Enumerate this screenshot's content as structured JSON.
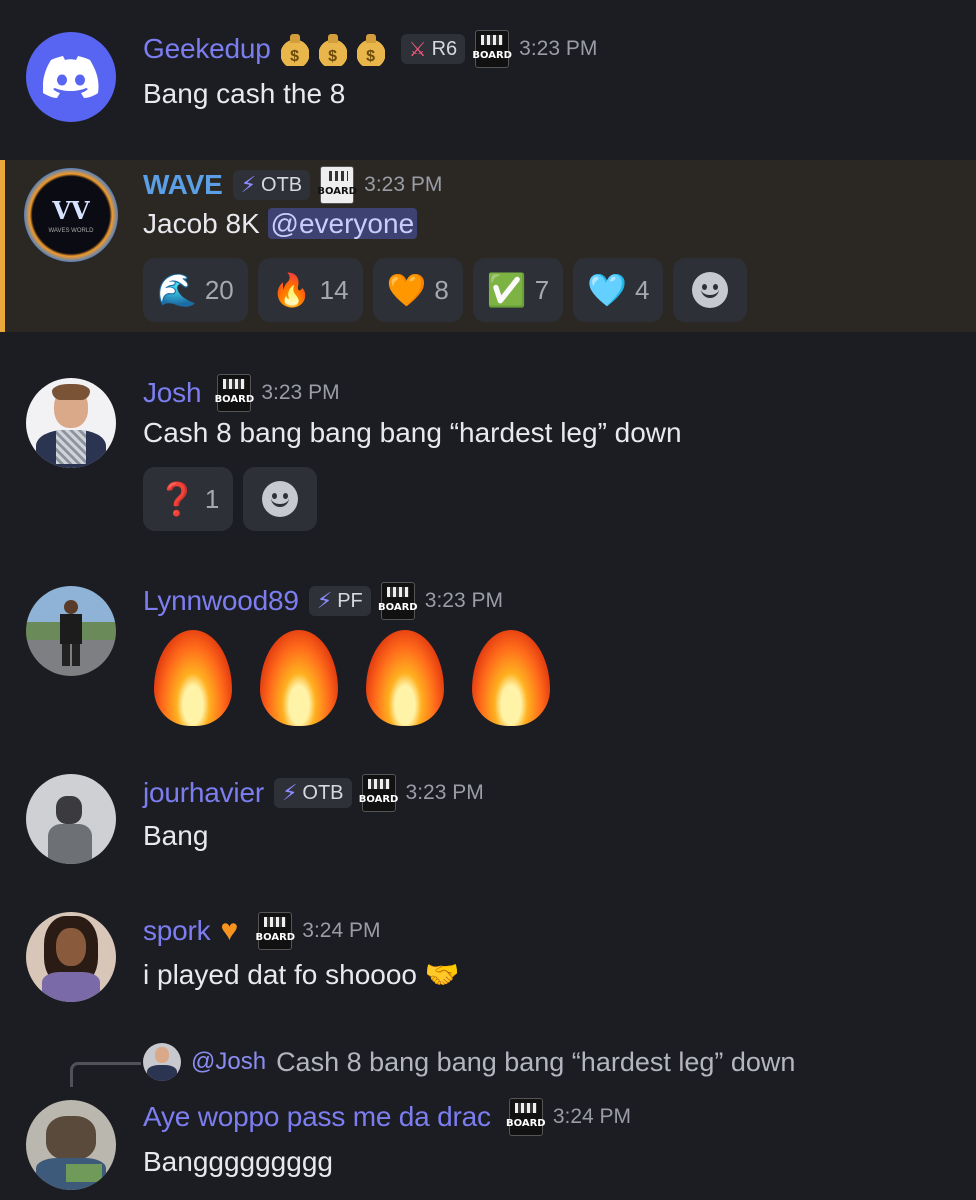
{
  "messages": [
    {
      "username": "Geekedup",
      "time": "3:23 PM",
      "tag_label": "R6",
      "board": "BOARD",
      "text": "Bang cash the 8",
      "bag_symbol": "$"
    },
    {
      "username": "WAVE",
      "time": "3:23 PM",
      "tag_label": "OTB",
      "board": "BOARD",
      "text_prefix": "Jacob 8K ",
      "mention": "@everyone",
      "reactions": [
        {
          "emoji_name": "wave",
          "emoji": "🌊",
          "count": "20"
        },
        {
          "emoji_name": "fire",
          "emoji": "🔥",
          "count": "14"
        },
        {
          "emoji_name": "orange-heart",
          "emoji": "🧡",
          "count": "8"
        },
        {
          "emoji_name": "check-mark",
          "emoji": "✅",
          "count": "7"
        },
        {
          "emoji_name": "blue-heart",
          "emoji": "🩵",
          "count": "4"
        }
      ]
    },
    {
      "username": "Josh",
      "time": "3:23 PM",
      "board": "BOARD",
      "text": "Cash 8 bang bang bang “hardest leg” down",
      "reactions": [
        {
          "emoji_name": "question-mark",
          "emoji": "❓",
          "count": "1"
        }
      ]
    },
    {
      "username": "Lynnwood89",
      "time": "3:23 PM",
      "tag_label": "PF",
      "board": "BOARD",
      "fire_count": 4
    },
    {
      "username": "jourhavier",
      "time": "3:23 PM",
      "tag_label": "OTB",
      "board": "BOARD",
      "text": "Bang"
    },
    {
      "username": "spork",
      "time": "3:24 PM",
      "board": "BOARD",
      "text": "i played dat fo shoooo",
      "text_emoji": "🤝"
    },
    {
      "username": "Aye woppo pass me da drac",
      "time": "3:24 PM",
      "board": "BOARD",
      "text": "Banggggggggg",
      "reply": {
        "name": "@Josh",
        "text": "Cash 8 bang bang bang “hardest leg” down"
      }
    }
  ],
  "colors": {
    "background": "#1c1d23",
    "username": "#7c7ef0",
    "highlight": "#2b2823",
    "highlight_border": "#e9a93a",
    "mention_bg": "#3d4272"
  },
  "wave_avatar_text": "WAVES WORLD"
}
